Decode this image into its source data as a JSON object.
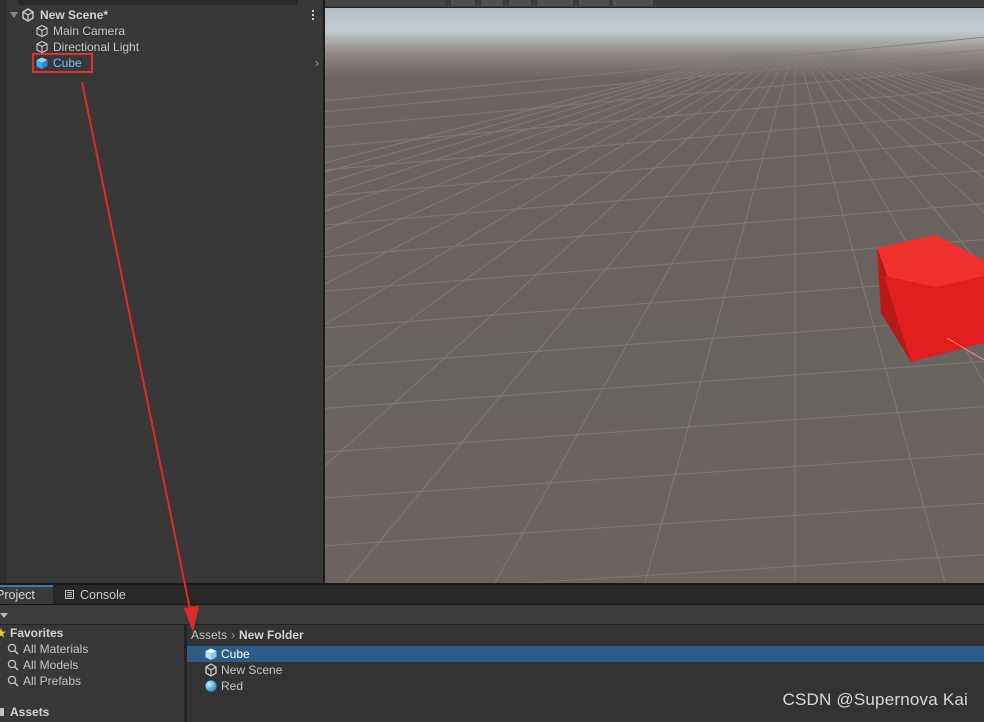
{
  "hierarchy": {
    "scene_name": "New Scene*",
    "items": [
      {
        "label": "Main Camera",
        "icon": "gameobject-icon"
      },
      {
        "label": "Directional Light",
        "icon": "gameobject-icon"
      },
      {
        "label": "Cube",
        "icon": "cube-prefab-icon",
        "selected": true
      }
    ]
  },
  "scene_view": {
    "shading_mode": "Shaded"
  },
  "bottom_panel": {
    "tabs": [
      "Project",
      "Console"
    ],
    "active_tab": "Project",
    "favorites": {
      "title": "Favorites",
      "items": [
        "All Materials",
        "All Models",
        "All Prefabs"
      ]
    },
    "assets_root": "Assets",
    "breadcrumb": [
      "Assets",
      "New Folder"
    ],
    "files": [
      {
        "name": "Cube",
        "icon": "prefab-icon",
        "selected": true
      },
      {
        "name": "New Scene",
        "icon": "unity-scene-icon"
      },
      {
        "name": "Red",
        "icon": "material-icon"
      }
    ]
  },
  "watermark": "CSDN @Supernova Kai",
  "colors": {
    "selection": "#2c5d87",
    "annotation_red": "#e03030",
    "cube_red": "#e21e1e",
    "prefab_blue": "#6cc3ff"
  }
}
